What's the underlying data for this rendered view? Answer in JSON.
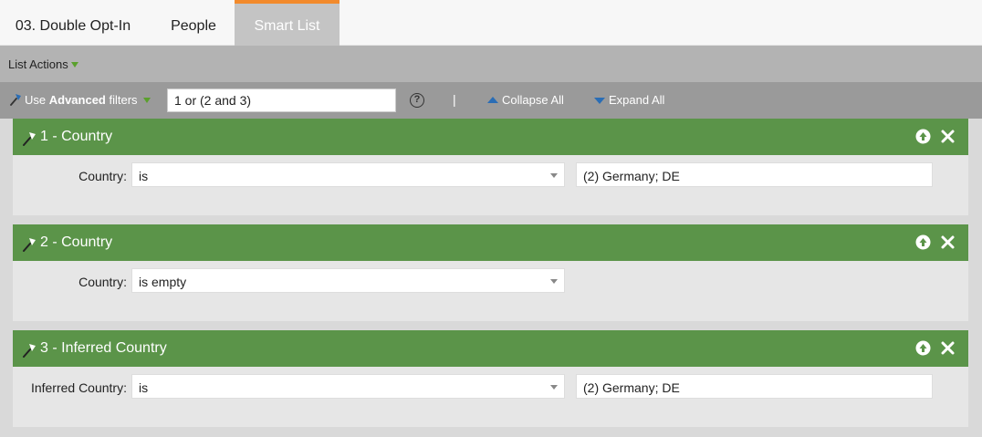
{
  "tabs": [
    {
      "label": "03. Double Opt-In"
    },
    {
      "label": "People"
    },
    {
      "label": "Smart List",
      "active": true
    }
  ],
  "list_actions": {
    "label": "List Actions"
  },
  "filter_bar": {
    "advanced_prefix": "Use ",
    "advanced_bold": "Advanced",
    "advanced_suffix": " filters",
    "logic_value": "1 or (2 and 3)",
    "help_glyph": "?",
    "separator": "|",
    "collapse_label": "Collapse All",
    "expand_label": "Expand All"
  },
  "filters": [
    {
      "title": "1 - Country",
      "field_label": "Country:",
      "operator": "is",
      "value": "(2) Germany; DE"
    },
    {
      "title": "2 - Country",
      "field_label": "Country:",
      "operator": "is empty",
      "value": ""
    },
    {
      "title": "3 - Inferred Country",
      "field_label": "Inferred Country:",
      "operator": "is",
      "value": "(2) Germany; DE"
    }
  ],
  "colors": {
    "filter_header": "#5b9449",
    "active_tab_accent": "#f28a2c",
    "link_triangle": "#2a6db5"
  },
  "icons": {
    "wand": "magic-wand-icon",
    "move_up": "arrow-up-circle-icon",
    "remove": "close-x-icon"
  }
}
